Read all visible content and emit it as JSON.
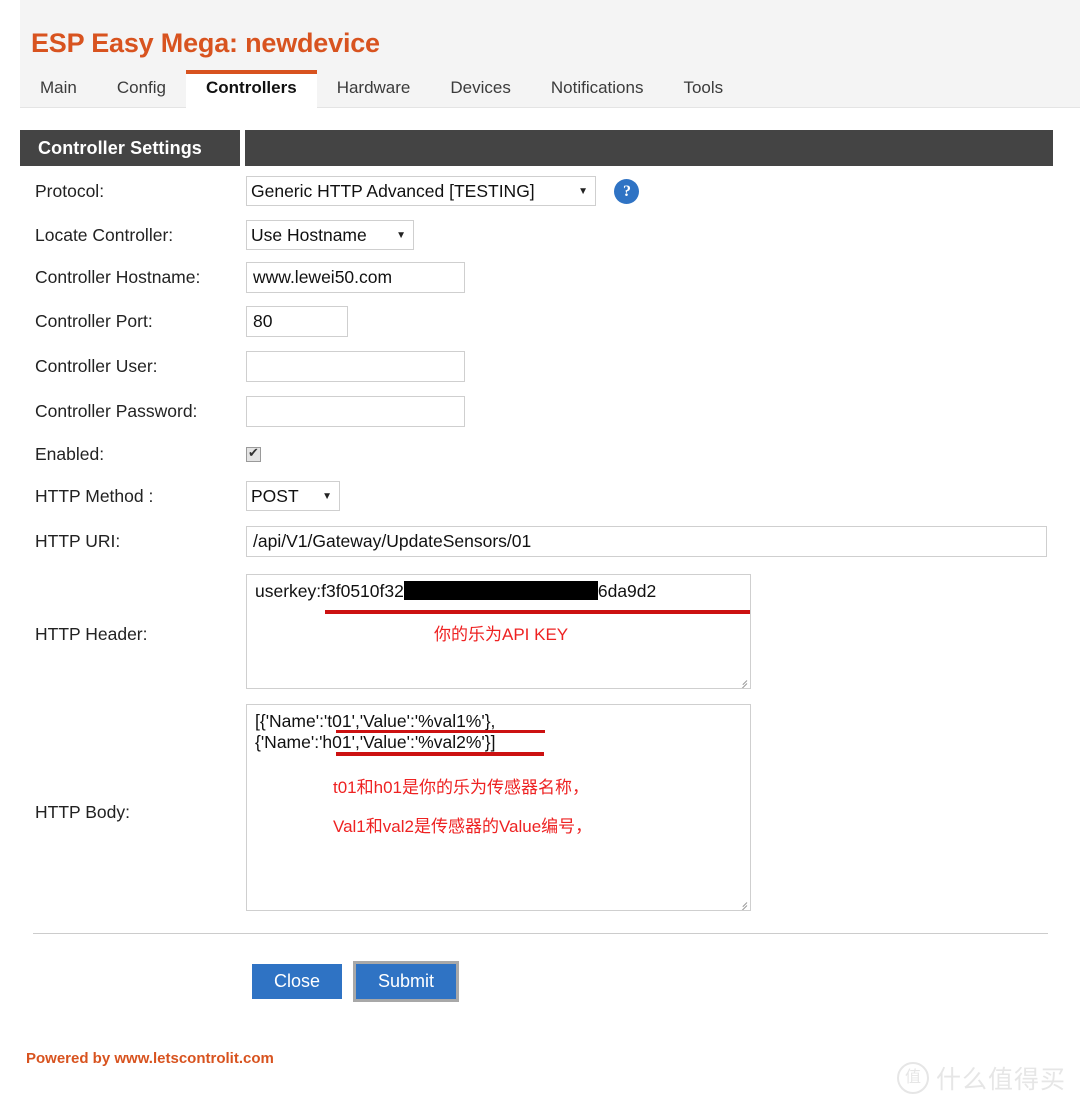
{
  "header": {
    "title": "ESP Easy Mega: newdevice",
    "brand_color": "#d8531f"
  },
  "tabs": [
    {
      "label": "Main",
      "active": false
    },
    {
      "label": "Config",
      "active": false
    },
    {
      "label": "Controllers",
      "active": true
    },
    {
      "label": "Hardware",
      "active": false
    },
    {
      "label": "Devices",
      "active": false
    },
    {
      "label": "Notifications",
      "active": false
    },
    {
      "label": "Tools",
      "active": false
    }
  ],
  "section": {
    "title": "Controller Settings"
  },
  "form": {
    "protocol": {
      "label": "Protocol:",
      "value": "Generic HTTP Advanced [TESTING]",
      "help_icon": "question-mark-icon"
    },
    "locate_controller": {
      "label": "Locate Controller:",
      "value": "Use Hostname"
    },
    "hostname": {
      "label": "Controller Hostname:",
      "value": "www.lewei50.com"
    },
    "port": {
      "label": "Controller Port:",
      "value": "80"
    },
    "user": {
      "label": "Controller User:",
      "value": ""
    },
    "password": {
      "label": "Controller Password:",
      "value": ""
    },
    "enabled": {
      "label": "Enabled:",
      "checked": true
    },
    "http_method": {
      "label": "HTTP Method :",
      "value": "POST"
    },
    "http_uri": {
      "label": "HTTP URI:",
      "value": "/api/V1/Gateway/UpdateSensors/01"
    },
    "http_header": {
      "label": "HTTP Header:",
      "value_prefix": "userkey:f3f0510f32",
      "value_redacted": "[REDACTED]",
      "value_suffix": "6da9d2",
      "annotation": "你的乐为API KEY"
    },
    "http_body": {
      "label": "HTTP Body:",
      "line1": "[{'Name':'t01','Value':'%val1%'},",
      "line2": "{'Name':'h01','Value':'%val2%'}]",
      "annotation1": "t01和h01是你的乐为传感器名称，",
      "annotation2": "Val1和val2是传感器的Value编号，"
    }
  },
  "buttons": {
    "close": "Close",
    "submit": "Submit"
  },
  "footer": {
    "text": "Powered by www.letscontrolit.com"
  },
  "watermark": {
    "badge": "值",
    "text": "什么值得买"
  }
}
